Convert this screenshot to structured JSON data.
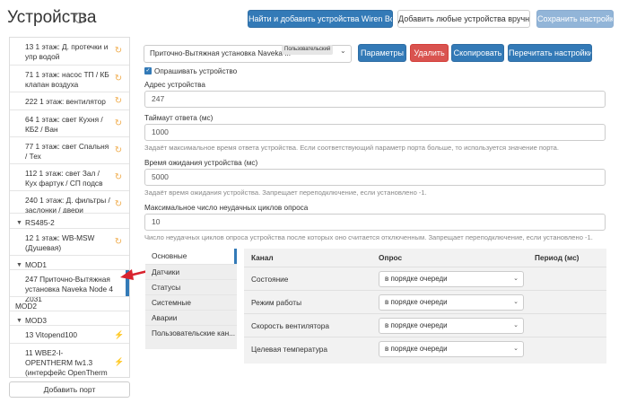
{
  "header": {
    "title": "Устройства",
    "buttons": {
      "find_wb": "Найти и добавить устройства Wiren Board",
      "add_manual": "Добавить любые устройства вручную",
      "save": "Сохранить настройки"
    }
  },
  "sidebar": {
    "items": [
      {
        "label": "13 1 этаж: Д. протечки и упр водой"
      },
      {
        "label": "71 1 этаж: насос ТП / КБ клапан воздуха"
      },
      {
        "label": "222 1 этаж: вентилятор"
      },
      {
        "label": "64 1 этаж: свет Кухня / КБ2 / Ван"
      },
      {
        "label": "77 1 этаж: свет Спальня / Тех"
      },
      {
        "label": "112 1 этаж: свет Зал / Кух фартук / СП подсв"
      },
      {
        "label": "240 1 этаж: Д. фильтры / заслонки / двери"
      }
    ],
    "ports": {
      "rs485_2": "RS485-2",
      "mod1": "MOD1",
      "mod2": "MOD2",
      "mod3": "MOD3"
    },
    "rs485_2_items": [
      {
        "label": "12 1 этаж: WB-MSW (Душевая)"
      }
    ],
    "mod1_items": [
      {
        "label": "247 Приточно-Вытяжная установка Naveka Node 4 Z031"
      }
    ],
    "mod3_items": [
      {
        "label": "13 Vitopend100"
      },
      {
        "label": "11 WBE2-I-OPENTHERM fw1.3 (интерфейс OpenTherm для котлов)"
      }
    ],
    "add_port": "Добавить порт"
  },
  "device": {
    "select_value": "Приточно-Вытяжная установка Naveka ...",
    "badge": "Пользовательский",
    "buttons": {
      "params": "Параметры",
      "delete": "Удалить",
      "copy": "Скопировать",
      "reread": "Перечитать настройки"
    },
    "poll_label": "Опрашивать устройство",
    "address_label": "Адрес устройства",
    "address_value": "247",
    "timeout_label": "Таймаут ответа (мс)",
    "timeout_value": "1000",
    "timeout_help": "Задаёт максимальное время ответа устройства. Если соответствующий параметр порта больше, то используется значение порта.",
    "wait_label": "Время ожидания устройства (мс)",
    "wait_value": "5000",
    "wait_help": "Задаёт время ожидания устройства. Запрещает переподключение, если установлено -1.",
    "maxfail_label": "Максимальное число неудачных циклов опроса",
    "maxfail_value": "10",
    "maxfail_help": "Число неудачных циклов опроса устройства после которых оно считается отключенным. Запрещает переподключение, если установлено -1."
  },
  "tabs": [
    {
      "label": "Основные"
    },
    {
      "label": "Датчики"
    },
    {
      "label": "Статусы"
    },
    {
      "label": "Системные"
    },
    {
      "label": "Аварии"
    },
    {
      "label": "Пользовательские кан..."
    }
  ],
  "channels": {
    "headers": {
      "channel": "Канал",
      "poll": "Опрос",
      "period": "Период (мс)"
    },
    "rows": [
      {
        "name": "Состояние",
        "poll": "в порядке очереди"
      },
      {
        "name": "Режим работы",
        "poll": "в порядке очереди"
      },
      {
        "name": "Скорость вентилятора",
        "poll": "в порядке очереди"
      },
      {
        "name": "Целевая температура",
        "poll": "в порядке очереди"
      }
    ]
  },
  "colors": {
    "primary": "#337ab7",
    "danger": "#d9534f",
    "warning": "#f0ad4e",
    "arrow": "#d9232e"
  }
}
